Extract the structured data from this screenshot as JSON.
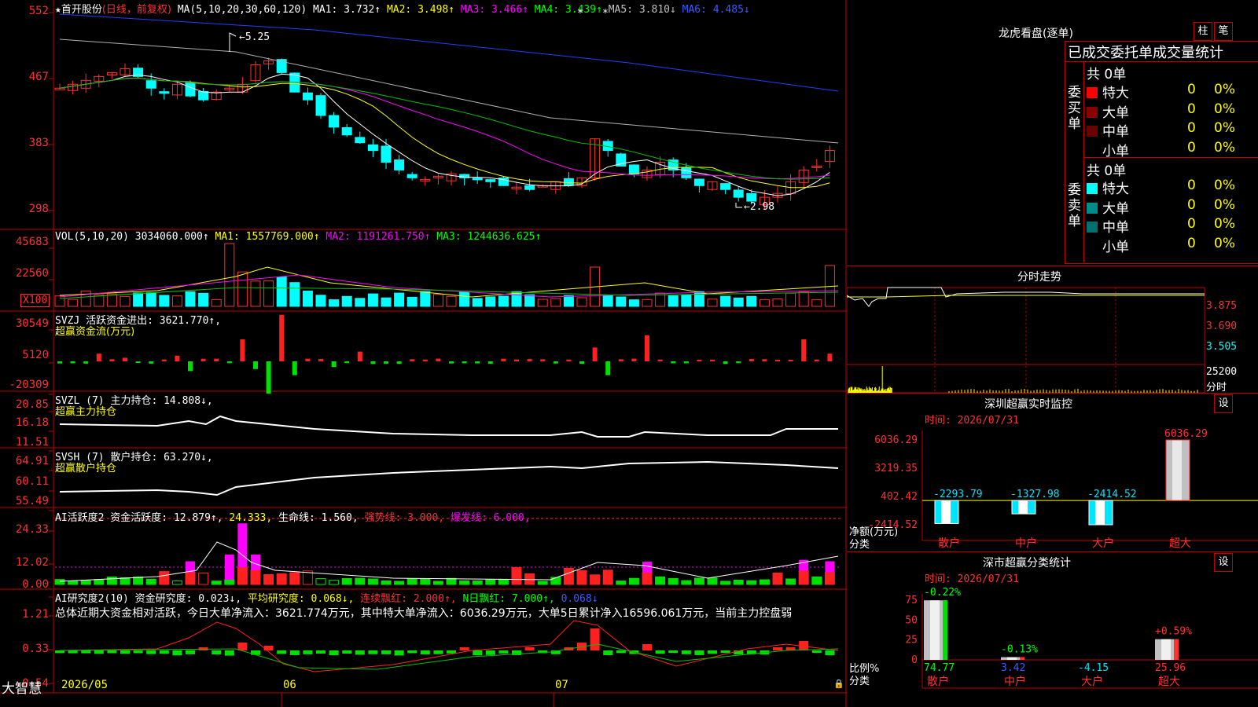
{
  "main_panel": {
    "star": "★",
    "stock_name": "首开股份",
    "period": "(日线，前复权)",
    "ma_label": "MA(5,10,20,30,60,120)",
    "ma1": "MA1: 3.732↑",
    "ma2": "MA2: 3.498↑",
    "ma3": "MA3: 3.466↑",
    "ma4": "MA4: 3.439↑",
    "ma5": "MA5: 3.810↓",
    "ma6": "MA6: 4.485↓",
    "y_ticks": [
      "552",
      "467",
      "383",
      "298"
    ],
    "high_mark": "5.25",
    "low_mark": "2.98"
  },
  "vol_panel": {
    "title": "VOL(5,10,20)",
    "value": "3034060.000↑",
    "ma1": "MA1: 1557769.000↑",
    "ma2": "MA2: 1191261.750↑",
    "ma3": "MA3: 1244636.625↑",
    "y_ticks": [
      "45683",
      "22560"
    ],
    "unit": "X100"
  },
  "svzj_panel": {
    "title": "SVZJ  活跃资金进出: 3621.770↑,",
    "subtitle": "超赢资金流(万元)",
    "y_ticks": [
      "30549",
      "5120",
      "-20309"
    ]
  },
  "svzl_panel": {
    "title": "SVZL (7) 主力持仓: 14.808↓,",
    "subtitle": "超赢主力持仓",
    "y_ticks": [
      "20.85",
      "16.18",
      "11.51"
    ]
  },
  "svsh_panel": {
    "title": "SVSH (7) 散户持仓: 63.270↓,",
    "subtitle": "超赢散户持仓",
    "y_ticks": [
      "64.91",
      "60.11",
      "55.49"
    ]
  },
  "ai_act_panel": {
    "title": "AI活跃度2 资金活跃度: 12.879↑,",
    "v2": "24.333,",
    "v3": "生命线: 1.560,",
    "v4": "强势线: 3.000,",
    "v5": "爆发线: 6.000,",
    "y_ticks": [
      "24.33",
      "12.02",
      "0.00"
    ]
  },
  "ai_res_panel": {
    "title": "AI研究度2(10) 资金研究度: 0.023↓,",
    "v2": "平均研究度: 0.068↓,",
    "v3": "连续飘红: 2.000↑,",
    "v4": "N日飘红: 7.000↑,",
    "v5": "0.068↓",
    "summary": "总体近期大资金相对活跃，今日大单净流入：3621.774万元，其中特大单净流入：6036.29万元，大单5日累计净入16596.061万元，当前主力控盘弱",
    "y_ticks": [
      "1.21",
      "0.33",
      "-0.54"
    ]
  },
  "bottom_axis": {
    "brand": "大智慧",
    "dates": [
      "2026/05",
      "06",
      "07"
    ]
  },
  "right_panel": {
    "lhb_title": "龙虎看盘(逐单)",
    "btn_bar": "柱",
    "btn_pen": "笔",
    "stats_title": "已成交委托单成交量统计",
    "buy_label": "委买单",
    "sell_label": "委卖单",
    "buy_total": "共 0单",
    "sell_total": "共 0单",
    "rows": [
      {
        "name": "特大",
        "count": "0",
        "pct": "0%"
      },
      {
        "name": "大单",
        "count": "0",
        "pct": "0%"
      },
      {
        "name": "中单",
        "count": "0",
        "pct": "0%"
      },
      {
        "name": "小单",
        "count": "0",
        "pct": "0%"
      }
    ],
    "buy_colors": [
      "#ff0000",
      "#8b0000",
      "#6b0000",
      "#000000"
    ],
    "sell_colors": [
      "#00ffff",
      "#008b8b",
      "#007070",
      "#000000"
    ],
    "intraday_title": "分时走势",
    "intraday_prices": [
      "3.875",
      "3.690",
      "3.505"
    ],
    "intraday_vol": "25200",
    "intraday_unit": "分时",
    "sz_monitor_title": "深圳超赢实时监控",
    "sz_monitor_time": "时间: 2026/07/31",
    "sz_monitor_btn": "设",
    "net_y_ticks": [
      "6036.29",
      "3219.35",
      "402.42",
      "-2414.52"
    ],
    "net_label": "净额(万元)",
    "cat_label": "分类",
    "net_values": [
      {
        "cat": "散户",
        "value": -2293.79,
        "label": "-2293.79"
      },
      {
        "cat": "中户",
        "value": -1327.98,
        "label": "-1327.98"
      },
      {
        "cat": "大户",
        "value": -2414.52,
        "label": "-2414.52"
      },
      {
        "cat": "超大",
        "value": 6036.29,
        "label": "6036.29"
      }
    ],
    "sz_class_title": "深市超赢分类统计",
    "sz_class_time": "时间: 2026/07/31",
    "sz_class_btn": "设",
    "ratio_y_ticks": [
      "75",
      "50",
      "25",
      "0"
    ],
    "ratio_label": "比例%",
    "ratio_cat_label": "分类",
    "ratio_values": [
      {
        "cat": "散户",
        "pct_label": "-0.22%",
        "value": 74.77,
        "label": "74.77"
      },
      {
        "cat": "中户",
        "pct_label": "-0.13%",
        "value": 3.42,
        "label": "3.42"
      },
      {
        "cat": "大户",
        "pct_label": "",
        "value": -4.15,
        "label": "-4.15"
      },
      {
        "cat": "超大",
        "pct_label": "+0.59%",
        "value": 25.96,
        "label": "25.96"
      }
    ]
  }
}
